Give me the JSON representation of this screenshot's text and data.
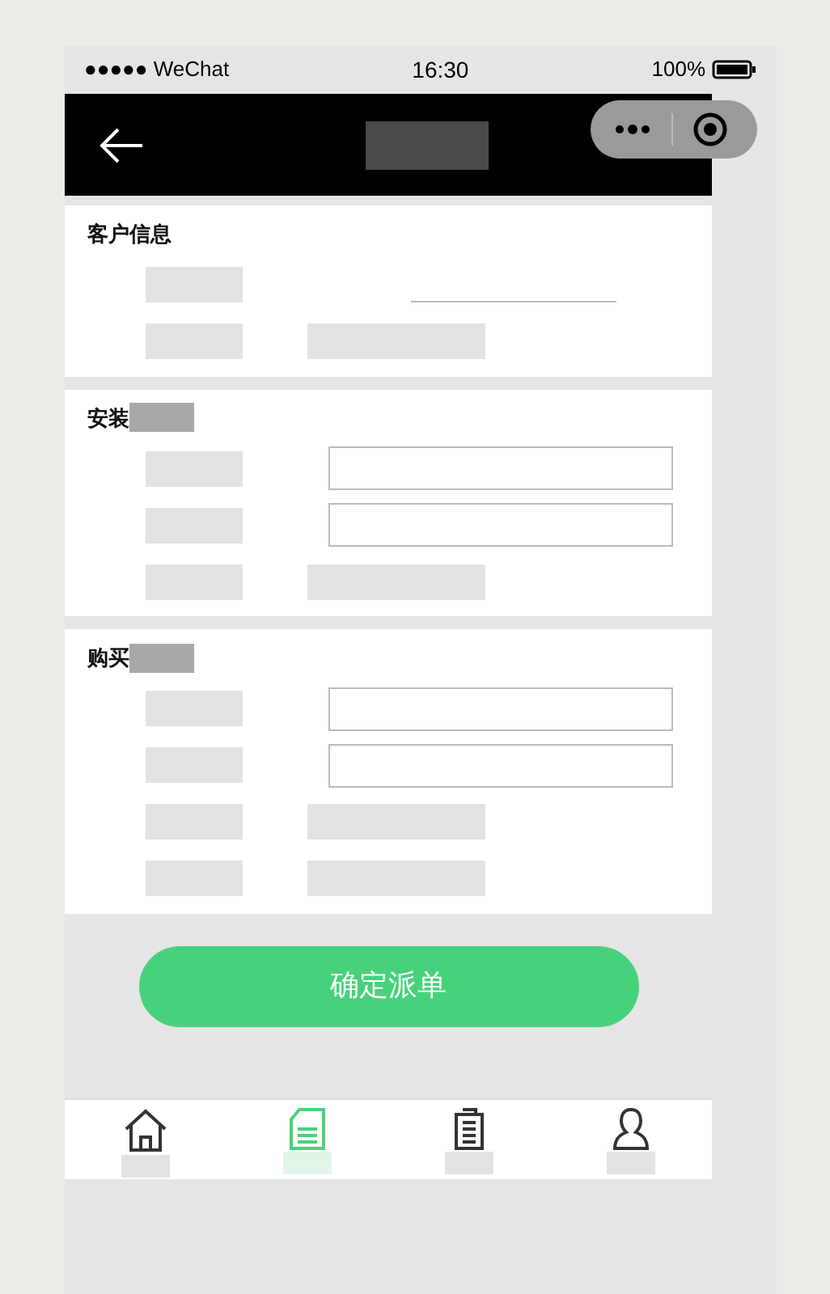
{
  "status_bar": {
    "carrier": "●●●●● WeChat",
    "time": "16:30",
    "battery": "100%"
  },
  "sections": [
    {
      "title": "客户信息",
      "rows": [
        {
          "kind": "underline"
        },
        {
          "kind": "plain"
        }
      ]
    },
    {
      "title": "安装",
      "rows": [
        {
          "kind": "field"
        },
        {
          "kind": "field"
        },
        {
          "kind": "plain"
        }
      ]
    },
    {
      "title": "购买",
      "rows": [
        {
          "kind": "field"
        },
        {
          "kind": "field"
        },
        {
          "kind": "plain"
        },
        {
          "kind": "plain"
        }
      ]
    }
  ],
  "submit_button": "确定派单",
  "tabs": [
    {
      "kind": "home",
      "selected": false
    },
    {
      "kind": "document",
      "selected": true
    },
    {
      "kind": "clipboard",
      "selected": false
    },
    {
      "kind": "person",
      "selected": false
    }
  ]
}
